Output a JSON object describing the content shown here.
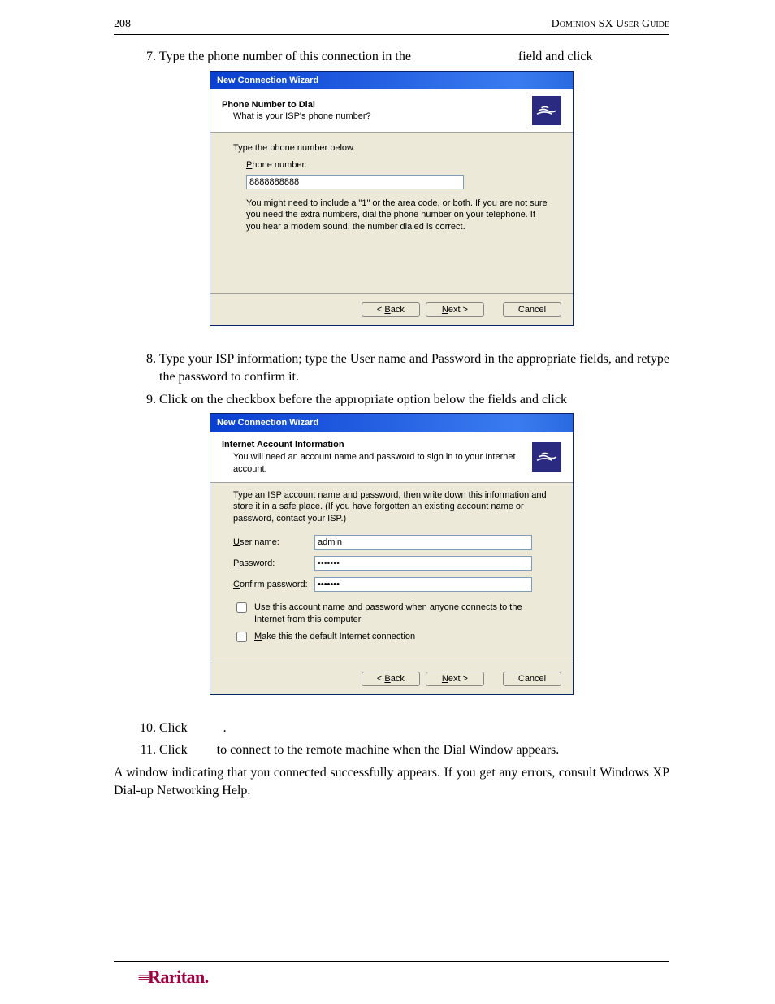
{
  "header": {
    "page_no": "208",
    "guide": "Dominion SX User Guide"
  },
  "steps": {
    "s7": "Type the phone number of this connection in the",
    "s7b": "field and click",
    "s8": "Type your ISP information; type the User name and Password in the appropriate fields, and retype the password to confirm it.",
    "s9": "Click on the checkbox before the appropriate option below the fields and click",
    "s10": "Click",
    "s10b": ".",
    "s11": "Click",
    "s11b": "to connect to the remote machine when the Dial Window appears."
  },
  "after": "A window indicating that you connected successfully appears. If you get any errors, consult Windows XP Dial-up Networking Help.",
  "wizard1": {
    "title": "New Connection Wizard",
    "header_title": "Phone Number to Dial",
    "header_sub": "What is your ISP's phone number?",
    "instr": "Type the phone number below.",
    "field_label": "Phone number:",
    "field_value": "8888888888",
    "note": "You might need to include a \"1\" or the area code, or both. If you are not sure you need the extra numbers, dial the phone number on your telephone. If you hear a modem sound, the number dialed is correct.",
    "back": "< Back",
    "next": "Next >",
    "cancel": "Cancel"
  },
  "wizard2": {
    "title": "New Connection Wizard",
    "header_title": "Internet Account Information",
    "header_sub": "You will need an account name and password to sign in to your Internet account.",
    "instr": "Type an ISP account name and password, then write down this information and store it in a safe place. (If you have forgotten an existing account name or password, contact your ISP.)",
    "user_label": "User name:",
    "user_value": "admin",
    "pass_label": "Password:",
    "pass_value": "•••••••",
    "conf_label": "Confirm password:",
    "conf_value": "•••••••",
    "chk1": "Use this account name and password when anyone connects to the Internet from this computer",
    "chk2": "Make this the default Internet connection",
    "back": "< Back",
    "next": "Next >",
    "cancel": "Cancel"
  },
  "logo": "Raritan."
}
